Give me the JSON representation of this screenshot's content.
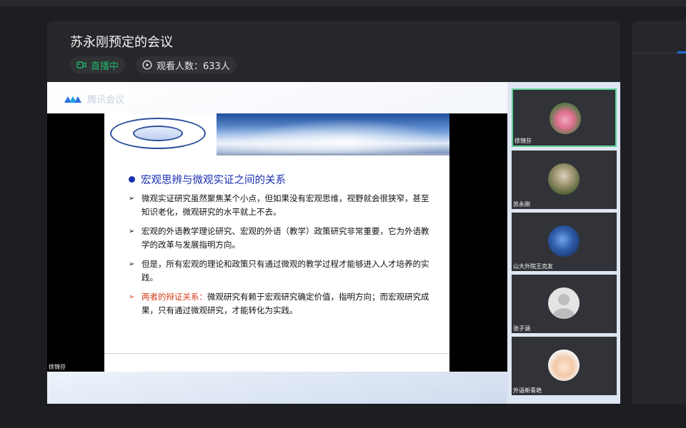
{
  "meeting": {
    "title": "苏永刚预定的会议",
    "live_label": "直播中",
    "viewers_label": "观看人数：633人"
  },
  "share": {
    "app_logo_text": "腾讯会议",
    "sharer_name": "徐锦芬",
    "slide": {
      "heading": "宏观思辨与微观实证之间的关系",
      "bullets": [
        {
          "text": "微观实证研究虽然聚焦某个小点，但如果没有宏观思维，视野就会很狭窄，甚至知识老化，微观研究的水平就上不去。"
        },
        {
          "text": "宏观的外语教学理论研究、宏观的外语（教学）政策研究非常重要，它为外语教学的改革与发展指明方向。"
        },
        {
          "text": "但是，所有宏观的理论和政策只有通过微观的教学过程才能够进入人才培养的实践。"
        },
        {
          "highlight": "两者的辩证关系：",
          "text": "微观研究有赖于宏观研究确定价值，指明方向；而宏观研究成果，只有通过微观研究，才能转化为实践。"
        }
      ]
    }
  },
  "participants": [
    {
      "name": "徐锦芬",
      "avatar": "lotus",
      "color": "#e88aa8"
    },
    {
      "name": "苏永刚",
      "avatar": "person-photo",
      "color": "#7a8a5a"
    },
    {
      "name": "山大外院王克友",
      "avatar": "night-sky",
      "color": "#2d5aa8"
    },
    {
      "name": "张子涵",
      "avatar": "default-user",
      "color": "#d0d0d0"
    },
    {
      "name": "外语新青艳",
      "avatar": "cartoon-girl",
      "color": "#f2c9a8"
    }
  ],
  "colors": {
    "live_green": "#22b46a",
    "active_tile_border": "#5fd39a",
    "slide_heading_blue": "#1a2fb0",
    "slide_highlight_red": "#d2401b"
  }
}
